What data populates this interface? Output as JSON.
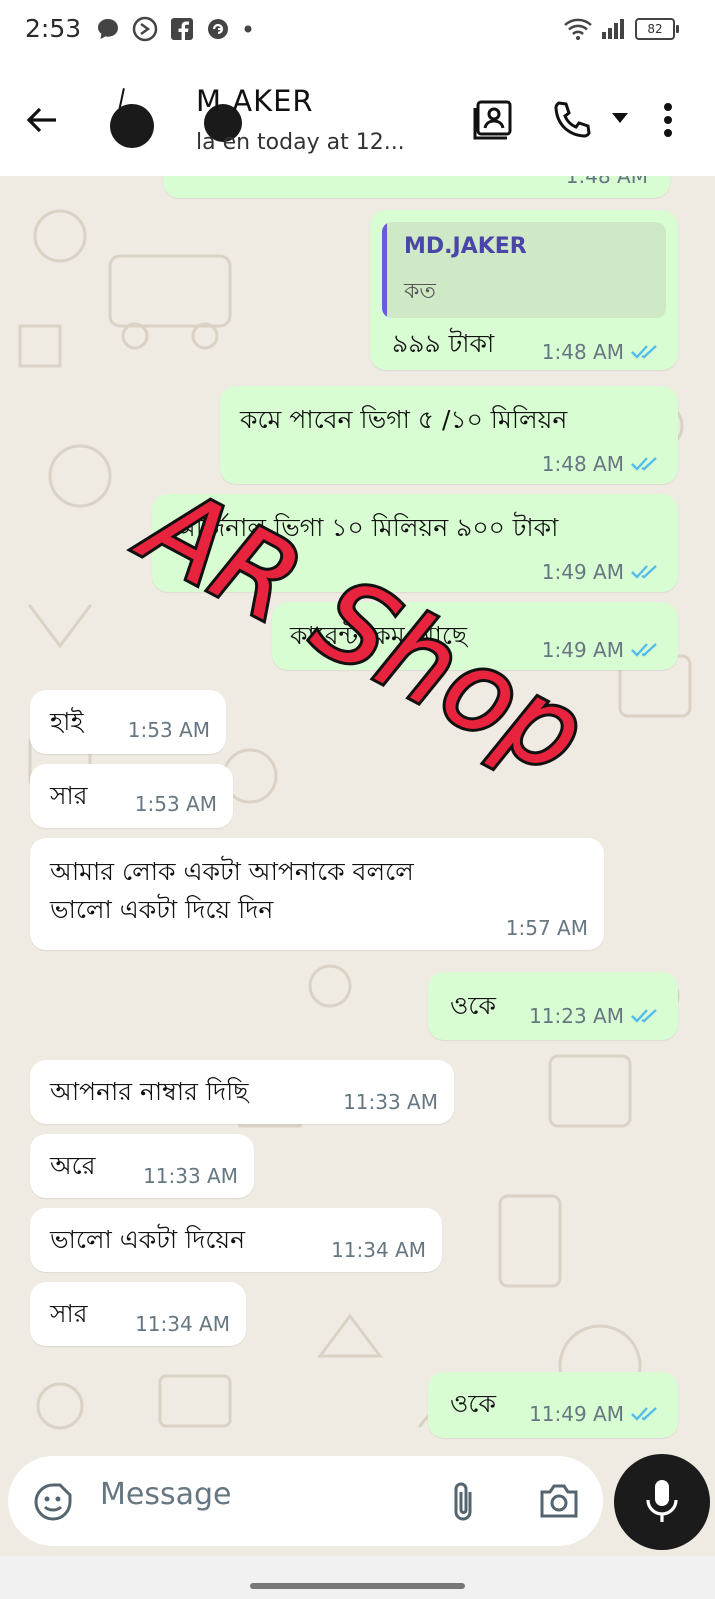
{
  "status_bar": {
    "time": "2:53",
    "battery": "82",
    "icons": [
      "chat-bubble-icon",
      "messenger-icon",
      "facebook-icon",
      "refresh-icon",
      "dot-icon",
      "wifi-icon",
      "signal-icon",
      "battery-icon"
    ]
  },
  "header": {
    "name": "MD.JAKER",
    "name_visible": "M        AKER",
    "status": "la        en today at 12..."
  },
  "colors": {
    "outgoing_bubble": "#d9fdd3",
    "incoming_bubble": "#ffffff",
    "chat_background": "#efeae2",
    "read_ticks": "#53bdeb",
    "watermark_fill": "#e8233e"
  },
  "messages": [
    {
      "dir": "out",
      "quote_name": "MD.JAKER",
      "quote_text": "কত",
      "text": "৯৯৯ টাকা",
      "time": "1:48 AM",
      "status": "read"
    },
    {
      "dir": "out",
      "text": "কমে পাবেন ভিগা ৫ /১০  মিলিয়ন",
      "time": "1:48 AM",
      "status": "read"
    },
    {
      "dir": "out",
      "text": "অর্জিনাল ভিগা ১০ মিলিয়ন  ৯০০ টাকা",
      "time": "1:49 AM",
      "status": "read"
    },
    {
      "dir": "out",
      "text": "কারেন্টা কম আছে",
      "time": "1:49 AM",
      "status": "read"
    },
    {
      "dir": "in",
      "text": "হাই",
      "time": "1:53 AM"
    },
    {
      "dir": "in",
      "text": "সার",
      "time": "1:53 AM"
    },
    {
      "dir": "in",
      "line1": "আমার লোক একটা  আপনাকে বললে",
      "line2": "ভালো একটা দিয়ে দিন",
      "time": "1:57 AM"
    },
    {
      "dir": "out",
      "text": "ওকে",
      "time": "11:23 AM",
      "status": "read"
    },
    {
      "dir": "in",
      "text": "আপনার নাম্বার দিছি",
      "time": "11:33 AM"
    },
    {
      "dir": "in",
      "text": "অরে",
      "time": "11:33 AM"
    },
    {
      "dir": "in",
      "text": "ভালো একটা দিয়েন",
      "time": "11:34 AM"
    },
    {
      "dir": "in",
      "text": "সার",
      "time": "11:34 AM"
    },
    {
      "dir": "out",
      "text": "ওকে",
      "time": "11:49 AM",
      "status": "read"
    }
  ],
  "partial_top_time": "1:48 AM",
  "watermark": "AR Shop",
  "composer": {
    "placeholder": "Message"
  }
}
